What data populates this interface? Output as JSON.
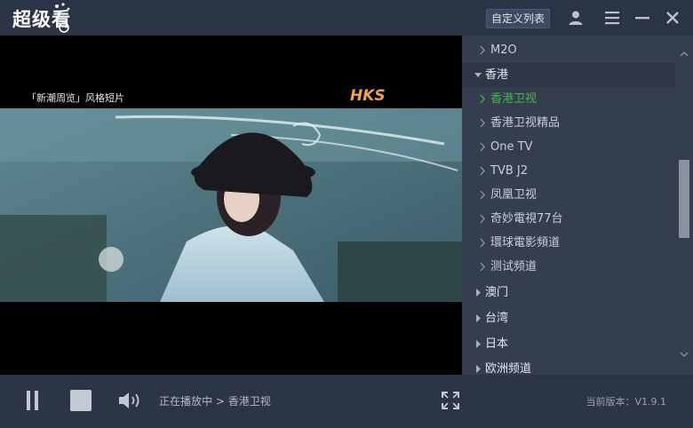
{
  "app": {
    "title": "超级看",
    "custom_list_label": "自定义列表"
  },
  "video": {
    "caption": "「新潮周览」风格短片",
    "channel_logo": "HKS"
  },
  "channels": [
    {
      "type": "channel",
      "label": "M2O"
    },
    {
      "type": "group",
      "label": "香港",
      "expanded": true
    },
    {
      "type": "channel",
      "label": "香港卫视",
      "active": true
    },
    {
      "type": "channel",
      "label": "香港卫视精品"
    },
    {
      "type": "channel",
      "label": "One TV"
    },
    {
      "type": "channel",
      "label": "TVB J2"
    },
    {
      "type": "channel",
      "label": "凤凰卫视"
    },
    {
      "type": "channel",
      "label": "奇妙電視77台"
    },
    {
      "type": "channel",
      "label": "環球電影頻道"
    },
    {
      "type": "channel",
      "label": "测试频道"
    },
    {
      "type": "group",
      "label": "澳门"
    },
    {
      "type": "group",
      "label": "台湾"
    },
    {
      "type": "group",
      "label": "日本"
    },
    {
      "type": "group",
      "label": "欧洲频道"
    }
  ],
  "status": {
    "playing_prefix": "正在播放中",
    "separator": ">",
    "current_channel": "香港卫视",
    "version": "当前版本：V1.9.1"
  },
  "colors": {
    "active_channel": "#3fb84a",
    "panel_bg": "#353e4e",
    "chrome_bg": "#2c3546"
  }
}
